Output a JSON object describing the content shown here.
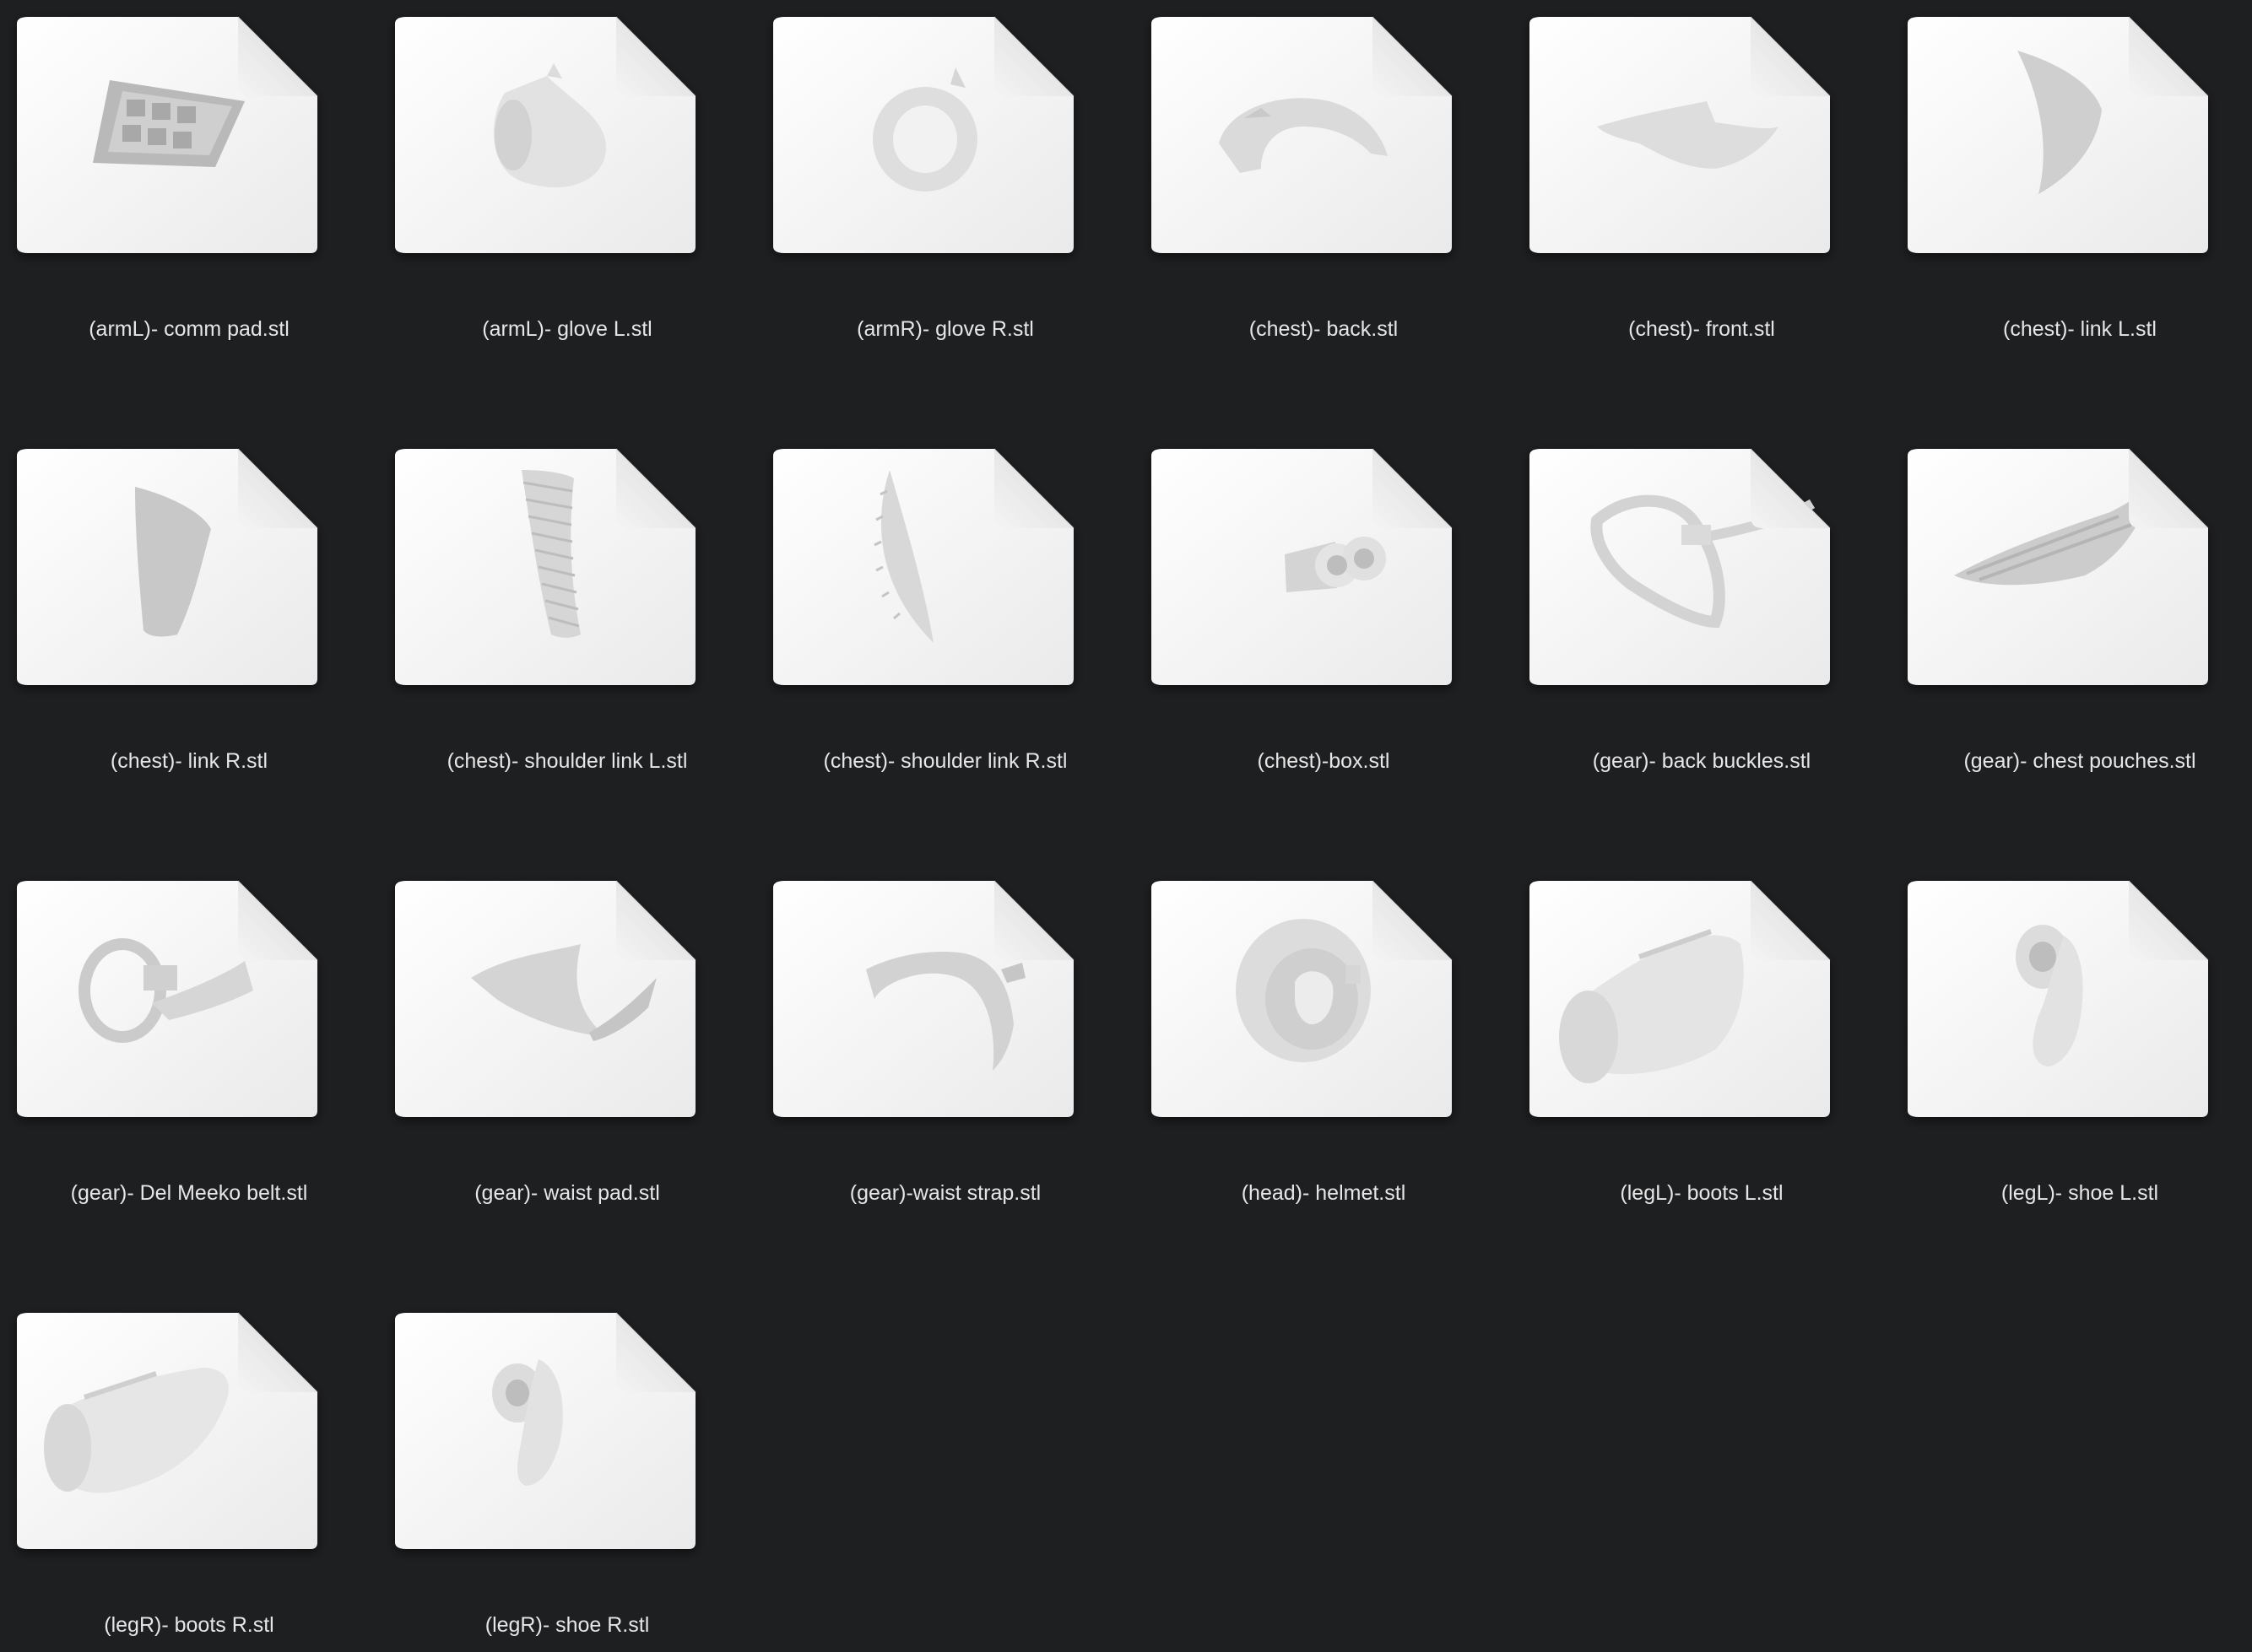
{
  "files": [
    {
      "name": "(armL)- comm pad.stl",
      "preview": "comm-pad"
    },
    {
      "name": "(armL)- glove L.stl",
      "preview": "glove-left"
    },
    {
      "name": "(armR)- glove R.stl",
      "preview": "glove-right"
    },
    {
      "name": "(chest)- back.stl",
      "preview": "chest-back"
    },
    {
      "name": "(chest)- front.stl",
      "preview": "chest-front"
    },
    {
      "name": "(chest)- link L.stl",
      "preview": "link-left"
    },
    {
      "name": "(chest)- link R.stl",
      "preview": "link-right"
    },
    {
      "name": "(chest)- shoulder link L.stl",
      "preview": "shoulder-link-left"
    },
    {
      "name": "(chest)- shoulder link R.stl",
      "preview": "shoulder-link-right"
    },
    {
      "name": "(chest)-box.stl",
      "preview": "chest-box"
    },
    {
      "name": "(gear)- back buckles.stl",
      "preview": "back-buckles"
    },
    {
      "name": "(gear)- chest pouches.stl",
      "preview": "chest-pouches"
    },
    {
      "name": "(gear)- Del Meeko belt.stl",
      "preview": "belt"
    },
    {
      "name": "(gear)- waist pad.stl",
      "preview": "waist-pad"
    },
    {
      "name": "(gear)-waist strap.stl",
      "preview": "waist-strap"
    },
    {
      "name": "(head)- helmet.stl",
      "preview": "helmet"
    },
    {
      "name": "(legL)- boots L.stl",
      "preview": "boot-left"
    },
    {
      "name": "(legL)- shoe L.stl",
      "preview": "shoe-left"
    },
    {
      "name": "(legR)- boots R.stl",
      "preview": "boot-right"
    },
    {
      "name": "(legR)- shoe R.stl",
      "preview": "shoe-right"
    }
  ]
}
